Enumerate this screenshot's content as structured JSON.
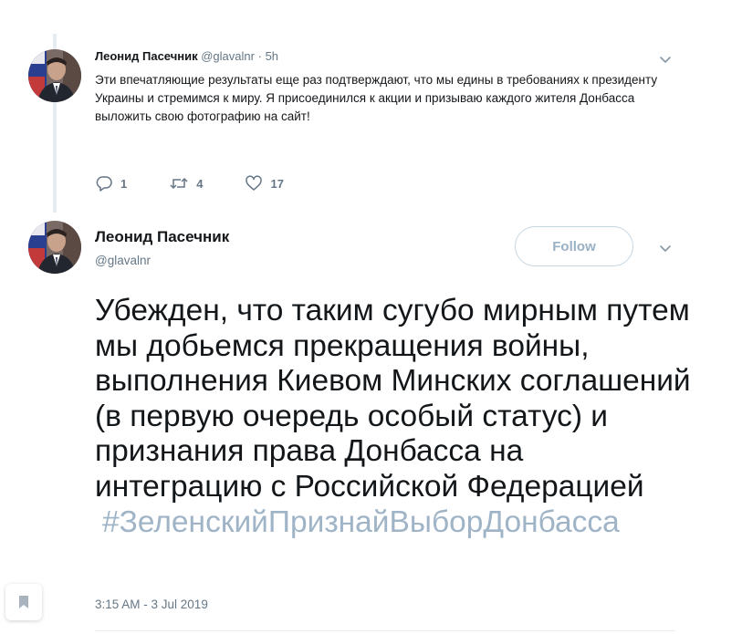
{
  "reply": {
    "author_name": "Леонид Пасечник",
    "author_handle": "@glavalnr",
    "separator": "·",
    "time": "5h",
    "text": "Эти впечатляющие результаты еще раз подтверждают, что мы едины в требованиях к президенту Украины и стремимся к миру. Я присоединился к акции и призываю каждого жителя Донбасса выложить свою фотографию на сайт!",
    "replies_count": "1",
    "retweets_count": "4",
    "likes_count": "17",
    "icons": [
      "reply-icon",
      "retweet-icon",
      "like-icon",
      "chevron-down-icon"
    ]
  },
  "main_tweet": {
    "author_name": "Леонид Пасечник",
    "author_handle": "@glavalnr",
    "follow_label": "Follow",
    "text": "Убежден, что таким сугубо мирным путем мы добьемся прекращения войны, выполнения Киевом Минских соглашений (в первую очередь особый статус) и признания права Донбасса на интеграцию с Российской Федерацией",
    "hashtag": "#ЗеленскийПризнайВыборДонбасса",
    "timestamp": "3:15 AM - 3 Jul 2019"
  },
  "sidebar": {
    "bookmark_icon": "bookmark-icon"
  },
  "colors": {
    "text": "#14171a",
    "muted": "#657786",
    "hashtag": "#9fb4c7",
    "follow_border": "#c5d6e3",
    "follow_text": "#9ab0c3",
    "divider": "#e6ecf0"
  }
}
